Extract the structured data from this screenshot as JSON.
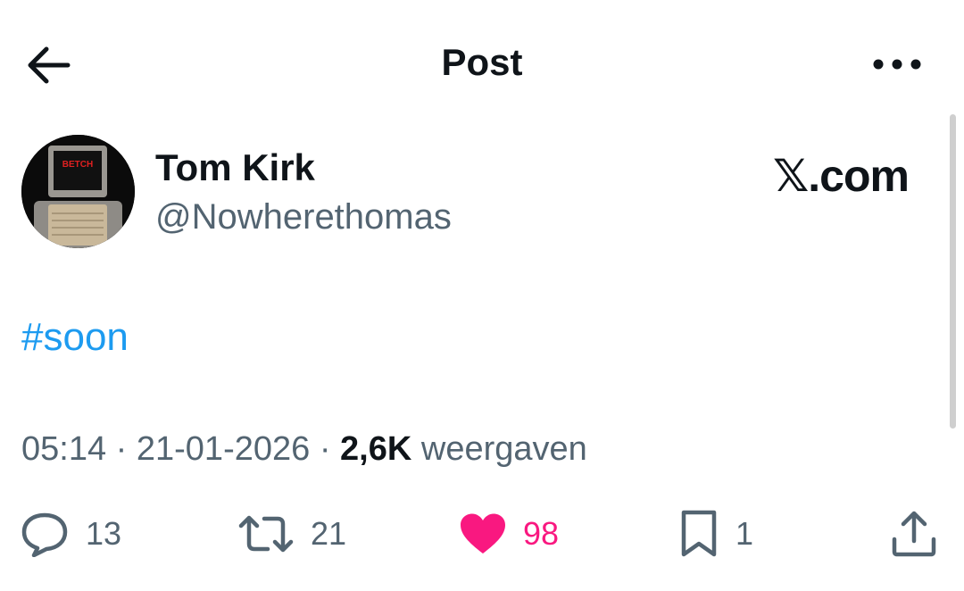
{
  "header": {
    "title": "Post",
    "back_icon": "arrow-left-icon",
    "more_icon": "more-horizontal-icon"
  },
  "author": {
    "name": "Tom Kirk",
    "handle": "@Nowherethomas",
    "avatar_text": "BETCH"
  },
  "brand": {
    "label": "𝕏.com"
  },
  "tweet": {
    "text": "#soon"
  },
  "meta": {
    "time": "05:14",
    "separator": "·",
    "date": "21-01-2026",
    "views_count": "2,6K",
    "views_label": "weergaven"
  },
  "actions": {
    "reply": {
      "icon": "reply-icon",
      "count": "13"
    },
    "repost": {
      "icon": "repost-icon",
      "count": "21"
    },
    "like": {
      "icon": "heart-icon",
      "count": "98",
      "active": true
    },
    "bookmark": {
      "icon": "bookmark-icon",
      "count": "1"
    },
    "share": {
      "icon": "share-icon"
    }
  },
  "colors": {
    "text_primary": "#0f1419",
    "text_secondary": "#536471",
    "link": "#1d9bf0",
    "like_active": "#f91880"
  }
}
